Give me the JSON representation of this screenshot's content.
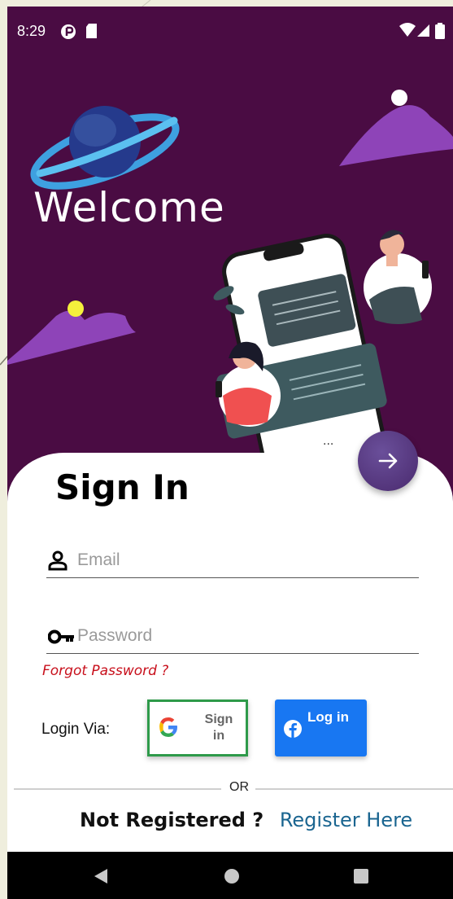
{
  "status_bar": {
    "time": "8:29"
  },
  "hero": {
    "welcome_text": "Welcome"
  },
  "signin": {
    "title": "Sign In",
    "email_placeholder": "Email",
    "password_placeholder": "Password",
    "forgot_password": "Forgot Password ?",
    "login_via_label": "Login Via:",
    "google_label": "Sign\nin",
    "facebook_label": "Log in",
    "or_text": "OR",
    "not_registered": "Not Registered ?",
    "register_link": "Register Here"
  },
  "colors": {
    "hero_background": "#4a0c43",
    "forgot_password": "#c8101c",
    "facebook_blue": "#1877f2",
    "google_border": "#2e9a4a",
    "register_link": "#1a6590"
  },
  "icons": {
    "next": "arrow-right-icon",
    "email": "person-icon",
    "password": "key-icon",
    "google": "google-icon",
    "facebook": "facebook-icon"
  }
}
